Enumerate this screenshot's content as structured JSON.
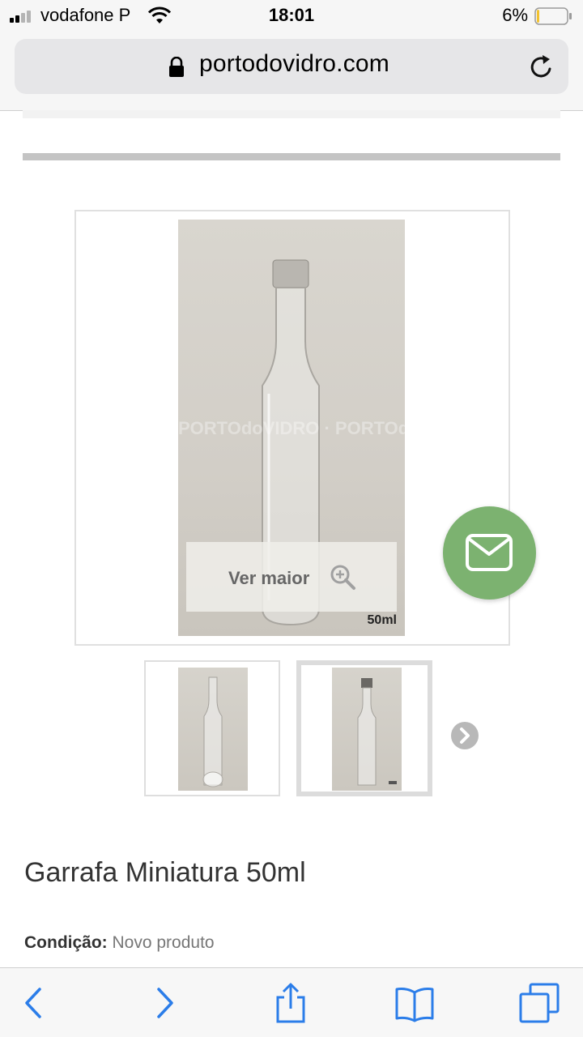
{
  "status_bar": {
    "carrier": "vodafone P",
    "time": "18:01",
    "battery_percent": "6%",
    "battery_level": 0.06,
    "signal_bars_filled": 2,
    "signal_bars_total": 4
  },
  "browser": {
    "url": "portodovidro.com"
  },
  "product": {
    "main_image": {
      "watermark": "PORTOdoVIDRO · PORTOdoVIDRO",
      "size_label": "50ml",
      "view_larger_label": "Ver maior"
    },
    "title": "Garrafa Miniatura 50ml",
    "condition_label": "Condição:",
    "condition_value": "Novo produto"
  },
  "colors": {
    "fab_green": "#7cb270",
    "ios_blue": "#2b7de9",
    "thumb_border_selected": "#dcdcdc"
  },
  "icons": {
    "mail": "envelope",
    "zoom": "magnifier-plus",
    "next": "chevron-right",
    "toolbar": [
      "back",
      "forward",
      "share",
      "bookmarks",
      "tabs"
    ]
  }
}
